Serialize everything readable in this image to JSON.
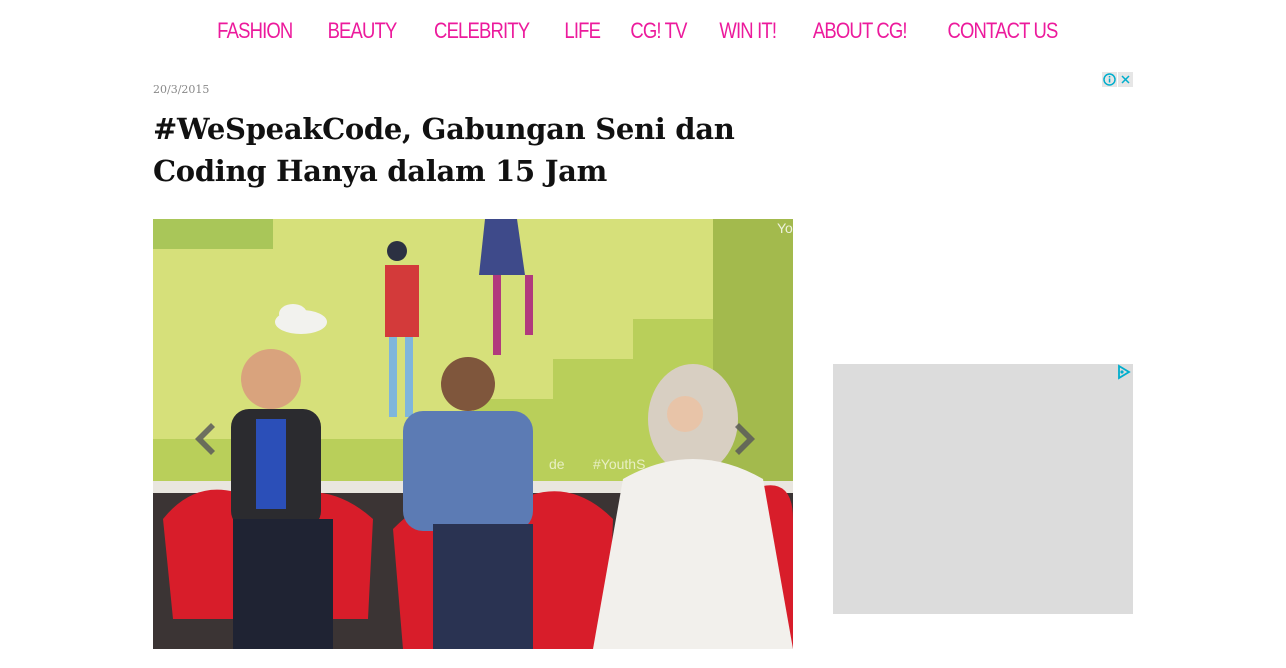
{
  "nav": {
    "items": [
      {
        "label": "FASHION"
      },
      {
        "label": "BEAUTY"
      },
      {
        "label": "CELEBRITY"
      },
      {
        "label": "LIFE"
      },
      {
        "label": "CG! TV"
      },
      {
        "label": "WIN IT!"
      },
      {
        "label": "ABOUT CG!"
      },
      {
        "label": "CONTACT US"
      }
    ]
  },
  "article": {
    "date": "20/3/2015",
    "title": "#WeSpeakCode, Gabungan Seni dan Coding Hanya dalam 15 Jam",
    "photo": {
      "screen_text_1": "#YouthS",
      "screen_text_2": "de",
      "screen_text_3": "Yo"
    }
  },
  "ads": {
    "adchoices_icon": "info-icon",
    "close_icon": "close-x-icon",
    "ad_unit_icon": "adchoices-triangle-icon"
  },
  "colors": {
    "nav_accent": "#ec1a9c",
    "title": "#111111",
    "ad_placeholder": "#dcdcdc"
  }
}
